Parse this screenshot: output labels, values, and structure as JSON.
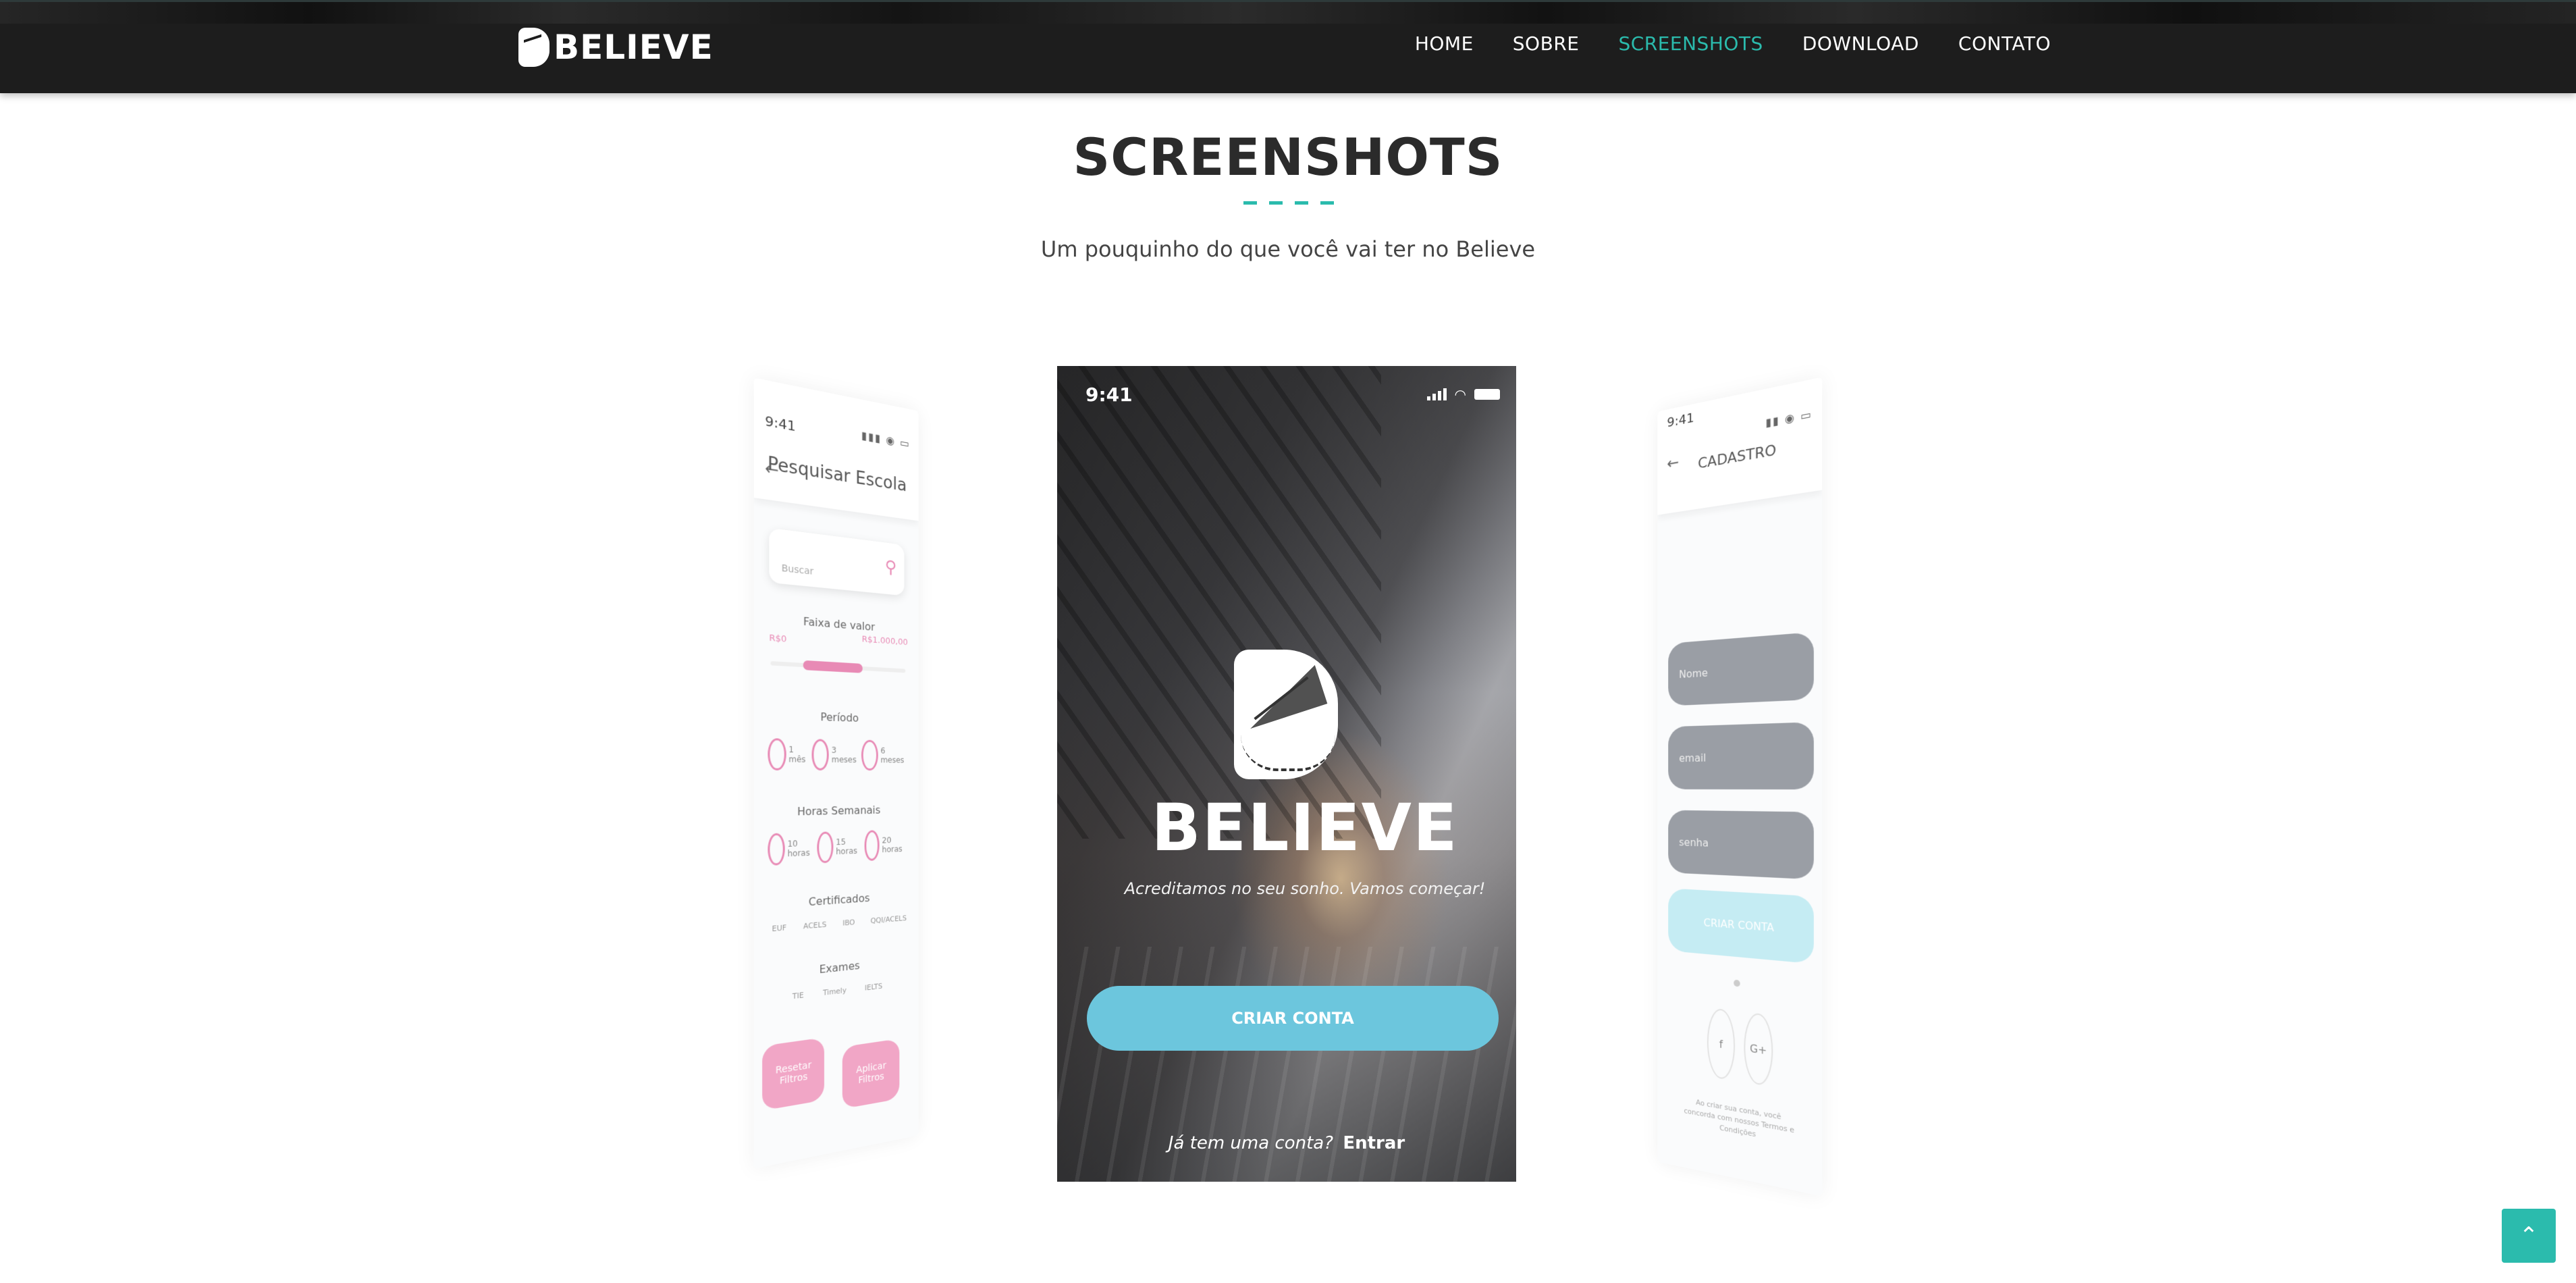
{
  "nav": {
    "brand": "BELIEVE",
    "items": [
      {
        "label": "HOME"
      },
      {
        "label": "SOBRE"
      },
      {
        "label": "SCREENSHOTS"
      },
      {
        "label": "DOWNLOAD"
      },
      {
        "label": "CONTATO"
      }
    ],
    "active_index": 2
  },
  "section": {
    "title": "SCREENSHOTS",
    "subtitle": "Um pouquinho do que você vai ter no Believe"
  },
  "left_phone": {
    "time": "9:41",
    "title": "Pesquisar Escola",
    "search_placeholder": "Buscar",
    "price_label": "Faixa de valor",
    "price_min": "R$0",
    "price_max": "R$1.000,00",
    "period_label": "Período",
    "period_options": [
      "1 mês",
      "3 meses",
      "6 meses"
    ],
    "hours_label": "Horas Semanais",
    "hours_options": [
      "10 horas",
      "15 horas",
      "20 horas"
    ],
    "certs_label": "Certificados",
    "certs_options": [
      "EUF",
      "ACELS",
      "IBO",
      "QQI/ACELS"
    ],
    "exams_label": "Exames",
    "exams_options": [
      "TIE",
      "Timely",
      "IELTS"
    ],
    "clear_button": "Resetar Filtros",
    "apply_button": "Aplicar Filtros"
  },
  "center_phone": {
    "time": "9:41",
    "brand": "BELIEVE",
    "tagline": "Acreditamos no seu sonho. Vamos começar!",
    "cta": "CRIAR CONTA",
    "login_question": "Já tem uma conta?",
    "login_action": "Entrar"
  },
  "right_phone": {
    "time": "9:41",
    "title": "CADASTRO",
    "name_placeholder": "Nome",
    "email_placeholder": "email",
    "password_placeholder": "senha",
    "create_button": "CRIAR CONTA",
    "facebook_icon_label": "f",
    "google_icon_label": "G+",
    "terms": "Ao criar sua conta, você concorda com nossos Termos e Condições"
  },
  "back_to_top": {
    "glyph": "⌃"
  },
  "colors": {
    "accent": "#2bbbad",
    "nav_bg": "#1d1d1d",
    "cta_blue": "#6cc6dd",
    "pink": "#e88ab5"
  }
}
